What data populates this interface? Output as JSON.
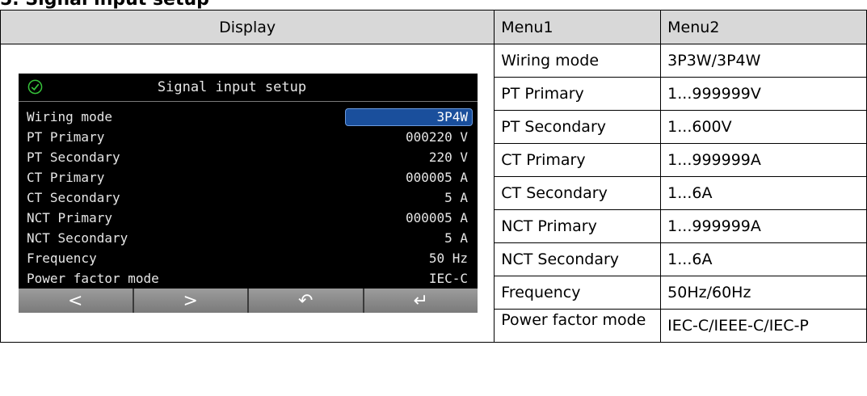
{
  "heading": "5. Signal input setup",
  "table": {
    "headers": {
      "display": "Display",
      "menu1": "Menu1",
      "menu2": "Menu2"
    },
    "rows": [
      {
        "menu1": "Wiring mode",
        "menu2": "3P3W/3P4W"
      },
      {
        "menu1": "PT Primary",
        "menu2": "1...999999V"
      },
      {
        "menu1": "PT Secondary",
        "menu2": "1...600V"
      },
      {
        "menu1": "CT Primary",
        "menu2": "1...999999A"
      },
      {
        "menu1": "CT Secondary",
        "menu2": "1...6A"
      },
      {
        "menu1": "NCT Primary",
        "menu2": "1...999999A"
      },
      {
        "menu1": "NCT Secondary",
        "menu2": "1...6A"
      },
      {
        "menu1": "Frequency",
        "menu2": "50Hz/60Hz"
      },
      {
        "menu1": "Power factor mode",
        "menu2": "IEC-C/IEEE-C/IEC-P"
      }
    ]
  },
  "screen": {
    "title": "Signal input setup",
    "icon": "check-circle-icon",
    "accent": "#1a4f9c",
    "items": [
      {
        "label": "Wiring mode",
        "value": "3P4W"
      },
      {
        "label": "PT Primary",
        "value": "000220 V"
      },
      {
        "label": "PT Secondary",
        "value": "220 V"
      },
      {
        "label": "CT Primary",
        "value": "000005 A"
      },
      {
        "label": "CT Secondary",
        "value": "5 A"
      },
      {
        "label": "NCT Primary",
        "value": "000005 A"
      },
      {
        "label": "NCT Secondary",
        "value": "5 A"
      },
      {
        "label": "Frequency",
        "value": "50 Hz"
      },
      {
        "label": "Power factor mode",
        "value": "IEC-C"
      }
    ],
    "softkeys": [
      {
        "glyph": "<",
        "icon": "left-arrow-icon"
      },
      {
        "glyph": ">",
        "icon": "right-arrow-icon"
      },
      {
        "glyph": "↶",
        "icon": "back-icon"
      },
      {
        "glyph": "↵",
        "icon": "enter-icon"
      }
    ]
  }
}
